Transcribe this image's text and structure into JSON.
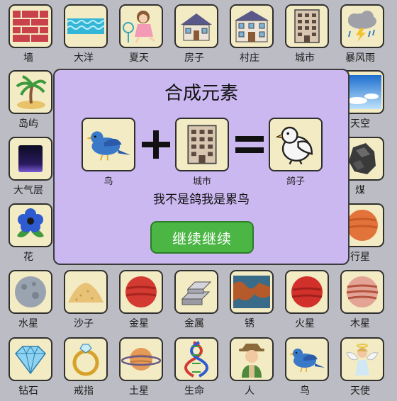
{
  "elements": {
    "wall": "墙",
    "ocean": "大洋",
    "summer": "夏天",
    "house": "房子",
    "village": "村庄",
    "city": "城市",
    "storm": "暴风雨",
    "island": "岛屿",
    "sky": "天空",
    "atmosphere": "大气层",
    "coal": "煤",
    "flower": "花",
    "planet": "行星",
    "mercury": "水星",
    "sand": "沙子",
    "venus": "金星",
    "metal": "金属",
    "rust": "锈",
    "mars": "火星",
    "jupiter": "木星",
    "diamond": "钻石",
    "ring": "戒指",
    "saturn": "土星",
    "life": "生命",
    "human": "人",
    "bird": "鸟",
    "angel": "天使"
  },
  "dialog": {
    "title": "合成元素",
    "input1": "鸟",
    "input2": "城市",
    "result": "鸽子",
    "message": "我不是鸽我是累鸟",
    "button": "继续继续"
  },
  "colors": {
    "dialog_bg": "#cbb8f1",
    "tile_bg": "#f3ebc3",
    "button": "#4cb644"
  }
}
